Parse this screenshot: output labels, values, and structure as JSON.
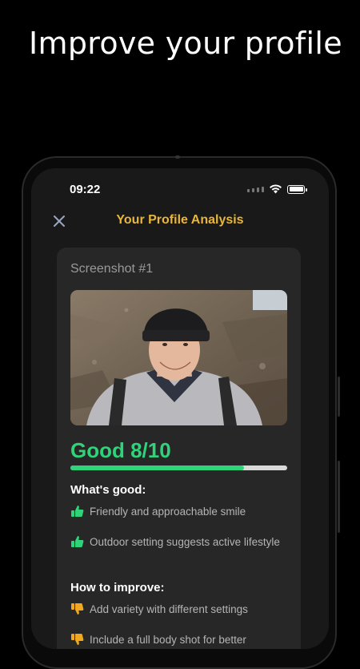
{
  "headline": "Improve your profile",
  "status_bar": {
    "time": "09:22",
    "icons": [
      "wifi-icon",
      "battery-icon"
    ]
  },
  "nav": {
    "close_icon": "close-icon",
    "title": "Your Profile Analysis"
  },
  "card": {
    "label": "Screenshot #1",
    "rating_label": "Good 8/10",
    "rating_progress": 0.8,
    "good": {
      "title": "What's good:",
      "items": [
        "Friendly and approachable smile",
        "Outdoor setting suggests active lifestyle"
      ]
    },
    "improve": {
      "title": "How to improve:",
      "items": [
        "Add variety with different settings",
        "Include a full body shot for better"
      ]
    }
  },
  "colors": {
    "accent_title": "#e8b73a",
    "rating_green": "#2ed37a",
    "thumb_up": "#2ed37a",
    "thumb_down": "#f0a820"
  }
}
